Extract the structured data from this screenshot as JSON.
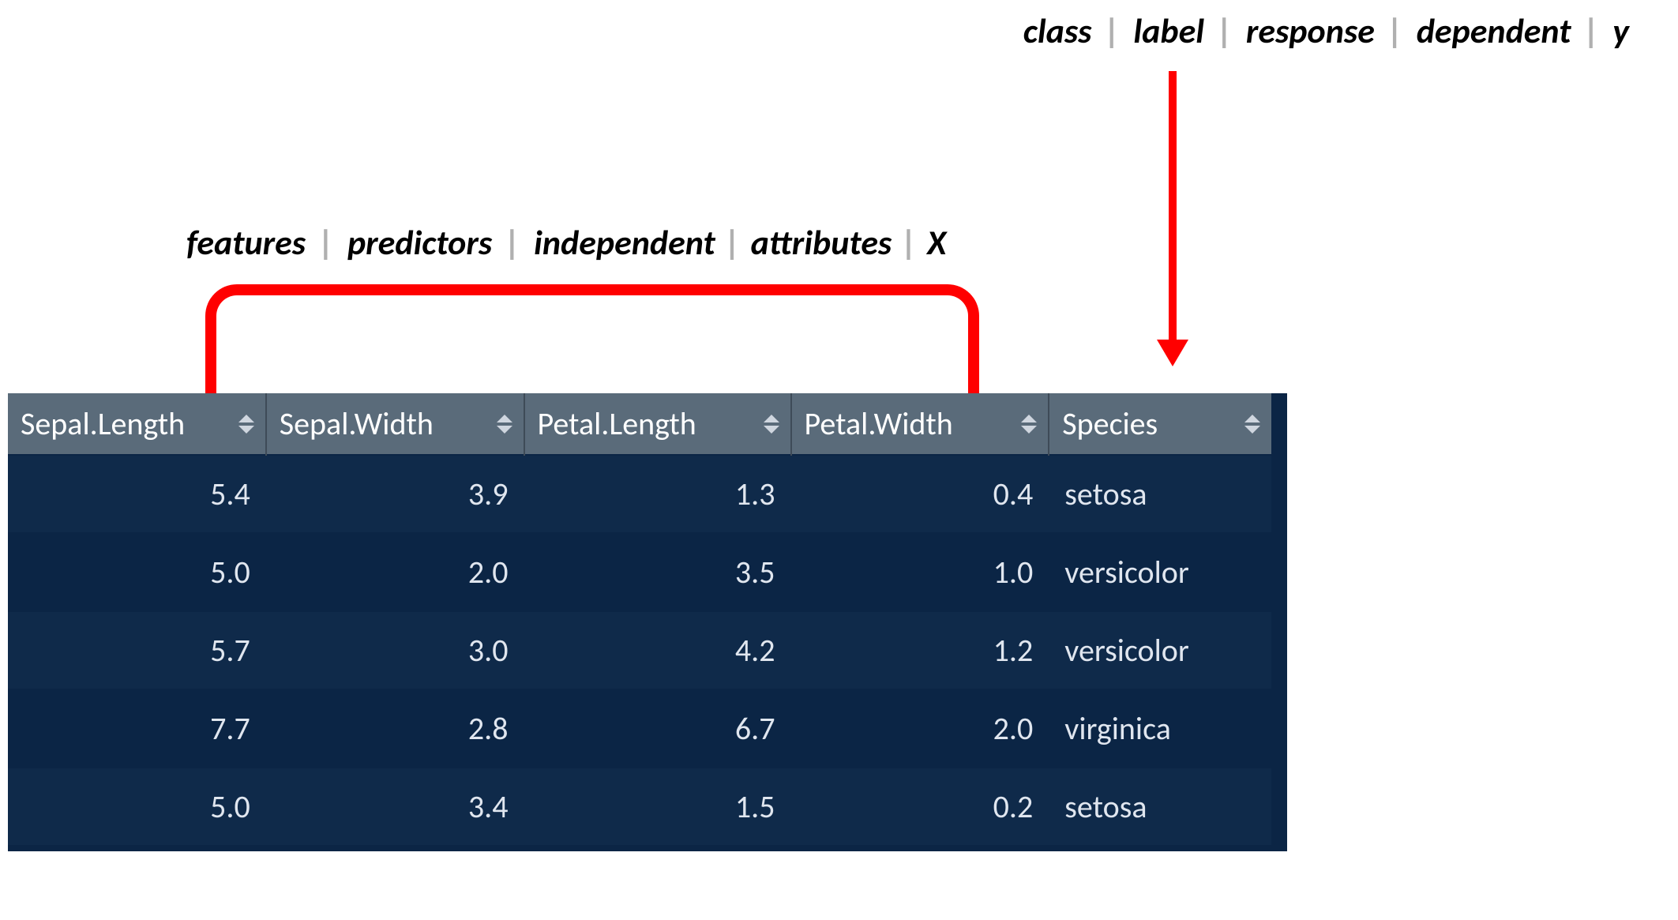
{
  "annotations": {
    "target": {
      "terms": [
        "class",
        "label",
        "response",
        "dependent",
        "y"
      ]
    },
    "features": {
      "terms": [
        "features",
        "predictors",
        "independent",
        "attributes",
        "X"
      ]
    }
  },
  "table": {
    "columns": [
      "Sepal.Length",
      "Sepal.Width",
      "Petal.Length",
      "Petal.Width",
      "Species"
    ],
    "rows": [
      {
        "sepal_length": "5.4",
        "sepal_width": "3.9",
        "petal_length": "1.3",
        "petal_width": "0.4",
        "species": "setosa"
      },
      {
        "sepal_length": "5.0",
        "sepal_width": "2.0",
        "petal_length": "3.5",
        "petal_width": "1.0",
        "species": "versicolor"
      },
      {
        "sepal_length": "5.7",
        "sepal_width": "3.0",
        "petal_length": "4.2",
        "petal_width": "1.2",
        "species": "versicolor"
      },
      {
        "sepal_length": "7.7",
        "sepal_width": "2.8",
        "petal_length": "6.7",
        "petal_width": "2.0",
        "species": "virginica"
      },
      {
        "sepal_length": "5.0",
        "sepal_width": "3.4",
        "petal_length": "1.5",
        "petal_width": "0.2",
        "species": "setosa"
      }
    ]
  },
  "chart_data": {
    "type": "table",
    "columns": [
      "Sepal.Length",
      "Sepal.Width",
      "Petal.Length",
      "Petal.Width",
      "Species"
    ],
    "feature_columns": [
      "Sepal.Length",
      "Sepal.Width",
      "Petal.Length",
      "Petal.Width"
    ],
    "target_column": "Species",
    "rows": [
      [
        5.4,
        3.9,
        1.3,
        0.4,
        "setosa"
      ],
      [
        5.0,
        2.0,
        3.5,
        1.0,
        "versicolor"
      ],
      [
        5.7,
        3.0,
        4.2,
        1.2,
        "versicolor"
      ],
      [
        7.7,
        2.8,
        6.7,
        2.0,
        "virginica"
      ],
      [
        5.0,
        3.4,
        1.5,
        0.2,
        "setosa"
      ]
    ]
  }
}
